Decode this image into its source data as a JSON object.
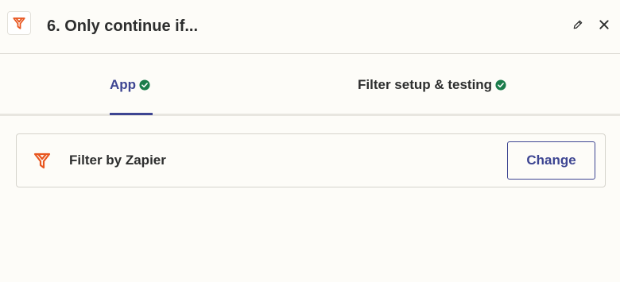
{
  "header": {
    "title": "6. Only continue if...",
    "app_icon": "filter-funnel-icon",
    "edit_icon": "pencil-icon",
    "close_icon": "close-icon"
  },
  "tabs": [
    {
      "label": "App",
      "status": "complete",
      "active": true
    },
    {
      "label": "Filter setup & testing",
      "status": "complete",
      "active": false
    }
  ],
  "app_card": {
    "app_name": "Filter by Zapier",
    "icon": "filter-funnel-icon",
    "change_label": "Change"
  },
  "colors": {
    "background": "#fdfcf8",
    "accent": "#3d4592",
    "brand_orange": "#e8561f",
    "success_green": "#1b7c4b",
    "text": "#2d2e2e",
    "border": "#d5d3cc"
  }
}
